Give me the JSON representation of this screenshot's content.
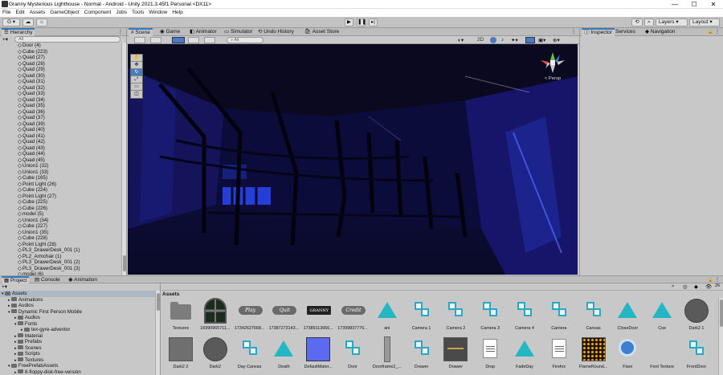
{
  "window": {
    "title": "Granny Mysterious Lighthouse - Normal - Android - Unity 2021.3.45f1 Personal <DX11>",
    "minimize": "—",
    "maximize": "☐",
    "close": "✕"
  },
  "menu": [
    "File",
    "Edit",
    "Assets",
    "GameObject",
    "Component",
    "Jobs",
    "Tools",
    "Window",
    "Help"
  ],
  "toolbar": {
    "account": "G ▾",
    "layers": "Layers",
    "layout": "Layout"
  },
  "hierarchy": {
    "title": "Hierarchy",
    "search": "All",
    "items": [
      "Door (4)",
      "Cube (223)",
      "Quad (27)",
      "Quad (28)",
      "Quad (29)",
      "Quad (30)",
      "Quad (31)",
      "Quad (32)",
      "Quad (33)",
      "Quad (34)",
      "Quad (35)",
      "Quad (36)",
      "Quad (37)",
      "Quad (39)",
      "Quad (40)",
      "Quad (41)",
      "Quad (42)",
      "Quad (43)",
      "Quad (44)",
      "Quad (45)",
      "Union1 (32)",
      "Union1 (33)",
      "Cube (165)",
      "Point Light (26)",
      "Cube (224)",
      "Point Light (27)",
      "Cube (225)",
      "Cube (226)",
      "model (5)",
      "Union1 (34)",
      "Cube (227)",
      "Union1 (35)",
      "Cube (228)",
      "Point Light (28)",
      "PL3_DrawerDesk_001 (1)",
      "PL2_Armchair (1)",
      "PL3_DrawerDesk_001 (2)",
      "PL3_DrawerDesk_001 (3)",
      "model (6)"
    ]
  },
  "scene_tabs": [
    "Scene",
    "Game",
    "Animator",
    "Simulator",
    "Undo History",
    "Asset Store"
  ],
  "scene": {
    "persp_label": "< Persp",
    "draw_mode": "2D"
  },
  "inspector_tabs": [
    "Inspector",
    "Services",
    "Navigation"
  ],
  "bottom_tabs": [
    "Project",
    "Console",
    "Animation"
  ],
  "project": {
    "tree": [
      {
        "label": "Assets",
        "indent": 0,
        "expanded": true
      },
      {
        "label": "Animations",
        "indent": 1
      },
      {
        "label": "Audios",
        "indent": 1
      },
      {
        "label": "Dynamic First Person Mobile",
        "indent": 1,
        "expanded": true
      },
      {
        "label": "Audios",
        "indent": 2
      },
      {
        "label": "Fonts",
        "indent": 2,
        "expanded": true
      },
      {
        "label": "tex-gyre-adventor",
        "indent": 3
      },
      {
        "label": "Material",
        "indent": 2
      },
      {
        "label": "Prefabs",
        "indent": 2
      },
      {
        "label": "Scenes",
        "indent": 2
      },
      {
        "label": "Scripts",
        "indent": 2
      },
      {
        "label": "Textures",
        "indent": 2
      },
      {
        "label": "FreePrefabAssets",
        "indent": 1,
        "expanded": true
      },
      {
        "label": "8-floppy-disk-free-version",
        "indent": 2
      }
    ],
    "breadcrumb": "Assets",
    "count_badge": "26",
    "assets_row1": [
      {
        "label": "Textures",
        "kind": "folder"
      },
      {
        "label": "16990965711...",
        "kind": "window"
      },
      {
        "label": "17342627668...",
        "kind": "pill",
        "text": "Play"
      },
      {
        "label": "17387273143...",
        "kind": "pill",
        "text": "Quit"
      },
      {
        "label": "17389113666...",
        "kind": "logo",
        "text": "GRANNY"
      },
      {
        "label": "17399837776...",
        "kind": "pill",
        "text": "Credit"
      },
      {
        "label": "ani",
        "kind": "tri"
      },
      {
        "label": "Camera 1",
        "kind": "prefab"
      },
      {
        "label": "Camera 2",
        "kind": "prefab"
      },
      {
        "label": "Camera 3",
        "kind": "prefab"
      },
      {
        "label": "Camera 4",
        "kind": "prefab"
      },
      {
        "label": "Camera",
        "kind": "prefab"
      },
      {
        "label": "Canvas",
        "kind": "prefab"
      },
      {
        "label": "CloseDoor",
        "kind": "tri"
      },
      {
        "label": "Coe",
        "kind": "tri"
      },
      {
        "label": "Dark2 1",
        "kind": "circ"
      }
    ],
    "assets_row2": [
      {
        "label": "Dark2 2",
        "kind": "sq"
      },
      {
        "label": "Dark2",
        "kind": "circ"
      },
      {
        "label": "Day Canvas",
        "kind": "prefab"
      },
      {
        "label": "Death",
        "kind": "tri"
      },
      {
        "label": "DefaultMater...",
        "kind": "blue"
      },
      {
        "label": "Door",
        "kind": "prefab"
      },
      {
        "label": "Doorframe2_...",
        "kind": "bar"
      },
      {
        "label": "Drawer",
        "kind": "prefab"
      },
      {
        "label": "Drawer",
        "kind": "drawer"
      },
      {
        "label": "Drop",
        "kind": "doc"
      },
      {
        "label": "FadeDay",
        "kind": "tri"
      },
      {
        "label": "Firefox",
        "kind": "doc"
      },
      {
        "label": "FlameRound...",
        "kind": "flame"
      },
      {
        "label": "Flare",
        "kind": "flare"
      },
      {
        "label": "Font Texture",
        "kind": "none"
      },
      {
        "label": "FrontDoor",
        "kind": "prefab"
      }
    ]
  },
  "colors": {
    "accent": "#3a79bb",
    "prefab": "#2aa7c2",
    "anim": "#23b7c6",
    "scene_dark": "#0b0b2e"
  }
}
